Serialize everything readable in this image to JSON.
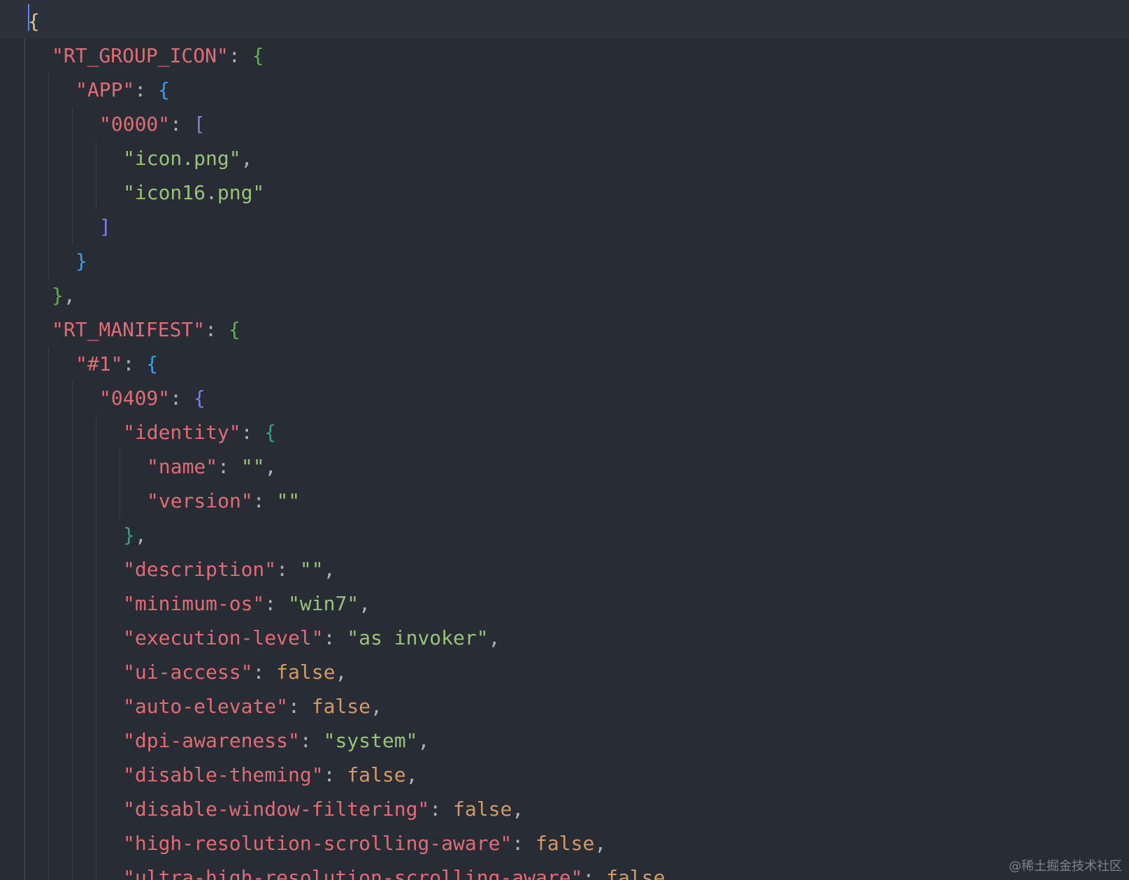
{
  "editor": {
    "language": "json",
    "lines": [
      [
        {
          "t": "{",
          "c": "br-y"
        }
      ],
      [
        {
          "t": "\"RT_GROUP_ICON\"",
          "c": "k"
        },
        {
          "t": ": ",
          "c": "p"
        },
        {
          "t": "{",
          "c": "br-g"
        }
      ],
      [
        {
          "t": "\"APP\"",
          "c": "k"
        },
        {
          "t": ": ",
          "c": "p"
        },
        {
          "t": "{",
          "c": "br-b"
        }
      ],
      [
        {
          "t": "\"0000\"",
          "c": "k"
        },
        {
          "t": ": ",
          "c": "p"
        },
        {
          "t": "[",
          "c": "br-v"
        }
      ],
      [
        {
          "t": "\"icon.png\"",
          "c": "s"
        },
        {
          "t": ",",
          "c": "p"
        }
      ],
      [
        {
          "t": "\"icon16.png\"",
          "c": "s"
        }
      ],
      [
        {
          "t": "]",
          "c": "br-v"
        }
      ],
      [
        {
          "t": "}",
          "c": "br-b"
        }
      ],
      [
        {
          "t": "}",
          "c": "br-g"
        },
        {
          "t": ",",
          "c": "p"
        }
      ],
      [
        {
          "t": "\"RT_MANIFEST\"",
          "c": "k"
        },
        {
          "t": ": ",
          "c": "p"
        },
        {
          "t": "{",
          "c": "br-g"
        }
      ],
      [
        {
          "t": "\"#1\"",
          "c": "k"
        },
        {
          "t": ": ",
          "c": "p"
        },
        {
          "t": "{",
          "c": "br-b"
        }
      ],
      [
        {
          "t": "\"0409\"",
          "c": "k"
        },
        {
          "t": ": ",
          "c": "p"
        },
        {
          "t": "{",
          "c": "br-v"
        }
      ],
      [
        {
          "t": "\"identity\"",
          "c": "k"
        },
        {
          "t": ": ",
          "c": "p"
        },
        {
          "t": "{",
          "c": "br-t"
        }
      ],
      [
        {
          "t": "\"name\"",
          "c": "k"
        },
        {
          "t": ": ",
          "c": "p"
        },
        {
          "t": "\"\"",
          "c": "s"
        },
        {
          "t": ",",
          "c": "p"
        }
      ],
      [
        {
          "t": "\"version\"",
          "c": "k"
        },
        {
          "t": ": ",
          "c": "p"
        },
        {
          "t": "\"\"",
          "c": "s"
        }
      ],
      [
        {
          "t": "}",
          "c": "br-t"
        },
        {
          "t": ",",
          "c": "p"
        }
      ],
      [
        {
          "t": "\"description\"",
          "c": "k"
        },
        {
          "t": ": ",
          "c": "p"
        },
        {
          "t": "\"\"",
          "c": "s"
        },
        {
          "t": ",",
          "c": "p"
        }
      ],
      [
        {
          "t": "\"minimum-os\"",
          "c": "k"
        },
        {
          "t": ": ",
          "c": "p"
        },
        {
          "t": "\"win7\"",
          "c": "s"
        },
        {
          "t": ",",
          "c": "p"
        }
      ],
      [
        {
          "t": "\"execution-level\"",
          "c": "k"
        },
        {
          "t": ": ",
          "c": "p"
        },
        {
          "t": "\"as invoker\"",
          "c": "s"
        },
        {
          "t": ",",
          "c": "p"
        }
      ],
      [
        {
          "t": "\"ui-access\"",
          "c": "k"
        },
        {
          "t": ": ",
          "c": "p"
        },
        {
          "t": "false",
          "c": "b"
        },
        {
          "t": ",",
          "c": "p"
        }
      ],
      [
        {
          "t": "\"auto-elevate\"",
          "c": "k"
        },
        {
          "t": ": ",
          "c": "p"
        },
        {
          "t": "false",
          "c": "b"
        },
        {
          "t": ",",
          "c": "p"
        }
      ],
      [
        {
          "t": "\"dpi-awareness\"",
          "c": "k"
        },
        {
          "t": ": ",
          "c": "p"
        },
        {
          "t": "\"system\"",
          "c": "s"
        },
        {
          "t": ",",
          "c": "p"
        }
      ],
      [
        {
          "t": "\"disable-theming\"",
          "c": "k"
        },
        {
          "t": ": ",
          "c": "p"
        },
        {
          "t": "false",
          "c": "b"
        },
        {
          "t": ",",
          "c": "p"
        }
      ],
      [
        {
          "t": "\"disable-window-filtering\"",
          "c": "k"
        },
        {
          "t": ": ",
          "c": "p"
        },
        {
          "t": "false",
          "c": "b"
        },
        {
          "t": ",",
          "c": "p"
        }
      ],
      [
        {
          "t": "\"high-resolution-scrolling-aware\"",
          "c": "k"
        },
        {
          "t": ": ",
          "c": "p"
        },
        {
          "t": "false",
          "c": "b"
        },
        {
          "t": ",",
          "c": "p"
        }
      ],
      [
        {
          "t": "\"ultra-high-resolution-scrolling-aware\"",
          "c": "k"
        },
        {
          "t": ": ",
          "c": "p"
        },
        {
          "t": "false",
          "c": "b"
        }
      ]
    ],
    "colors": {
      "background": "#282c34",
      "current_line": "#2c313c",
      "key": "#e06c75",
      "string": "#98c379",
      "boolean": "#d19a66",
      "punctuation": "#abb2bf",
      "bracket_level_1": "#e5c07b",
      "bracket_level_2": "#61b04a",
      "bracket_level_3": "#3b9eea",
      "bracket_level_4": "#7b7fe6",
      "bracket_level_5": "#2fa38f"
    }
  },
  "watermark": {
    "text": "@稀土掘金技术社区"
  }
}
